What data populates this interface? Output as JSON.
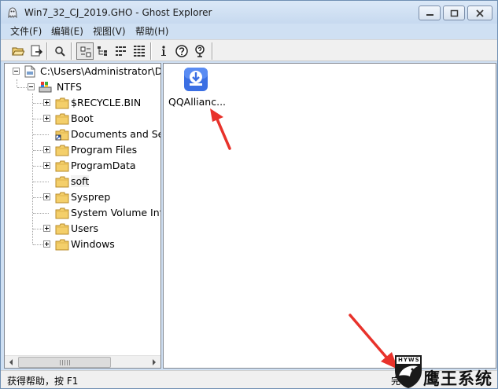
{
  "window": {
    "title": "Win7_32_CJ_2019.GHO - Ghost Explorer"
  },
  "menu": [
    "文件(F)",
    "编辑(E)",
    "视图(V)",
    "帮助(H)"
  ],
  "toolbar": [
    "open-icon",
    "extract-icon",
    "view-icon",
    "large-icons-icon",
    "tree-icon",
    "list-icon",
    "details-icon",
    "info-icon",
    "help-icon",
    "context-help-icon"
  ],
  "tree": {
    "root": "C:\\Users\\Administrator\\De",
    "partition": "NTFS",
    "items": [
      {
        "label": "$RECYCLE.BIN",
        "expandable": true
      },
      {
        "label": "Boot",
        "expandable": true
      },
      {
        "label": "Documents and Set",
        "expandable": false
      },
      {
        "label": "Program Files",
        "expandable": true
      },
      {
        "label": "ProgramData",
        "expandable": true
      },
      {
        "label": "soft",
        "expandable": false,
        "selected": true
      },
      {
        "label": "Sysprep",
        "expandable": true
      },
      {
        "label": "System Volume Info",
        "expandable": false
      },
      {
        "label": "Users",
        "expandable": true
      },
      {
        "label": "Windows",
        "expandable": true
      }
    ]
  },
  "files": [
    {
      "name": "QQAllianc...",
      "icon": "installer-icon"
    }
  ],
  "status": {
    "help_text": "获得帮助，按 F1",
    "right_text": "完"
  },
  "watermark": {
    "badge": "HYWS",
    "text": "鹰王系统"
  },
  "colors": {
    "title_bar": "#d3e3f5",
    "annotation_arrow": "#e8322b",
    "folder": "#f4cf6a"
  }
}
